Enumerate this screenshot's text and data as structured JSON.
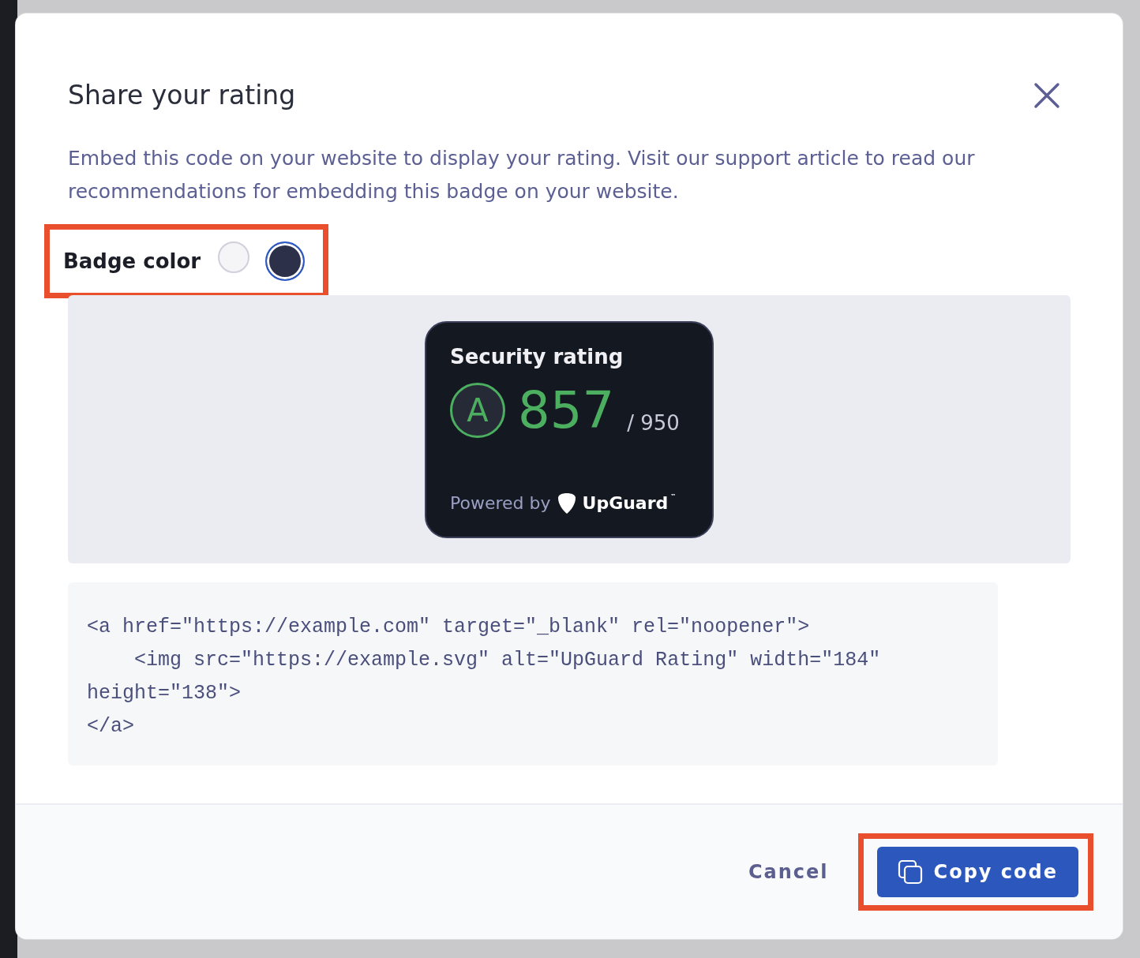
{
  "dialog": {
    "title": "Share your rating",
    "description": "Embed this code on your website to display your rating. Visit our support article to read our recommendations for embedding this badge on your website."
  },
  "badge_color": {
    "label": "Badge color",
    "highlighted": true,
    "options": [
      {
        "color": "#f5f5f8",
        "selected": false
      },
      {
        "color": "#2c3049",
        "selected": true
      }
    ]
  },
  "badge": {
    "title": "Security rating",
    "grade": "A",
    "score": "857",
    "max": "/ 950",
    "powered_by": "Powered by",
    "brand": "UpGuard",
    "trademark": "™"
  },
  "code": [
    "<a href=\"https://example.com\" target=\"_blank\" rel=\"noopener\">",
    "    <img src=\"https://example.svg\" alt=\"UpGuard Rating\" width=\"184\" height=\"138\">",
    "</a>"
  ],
  "buttons": [
    {
      "kind": "text",
      "label": "Cancel",
      "highlighted": false
    },
    {
      "kind": "primary",
      "label": "Copy code",
      "highlighted": true
    }
  ]
}
